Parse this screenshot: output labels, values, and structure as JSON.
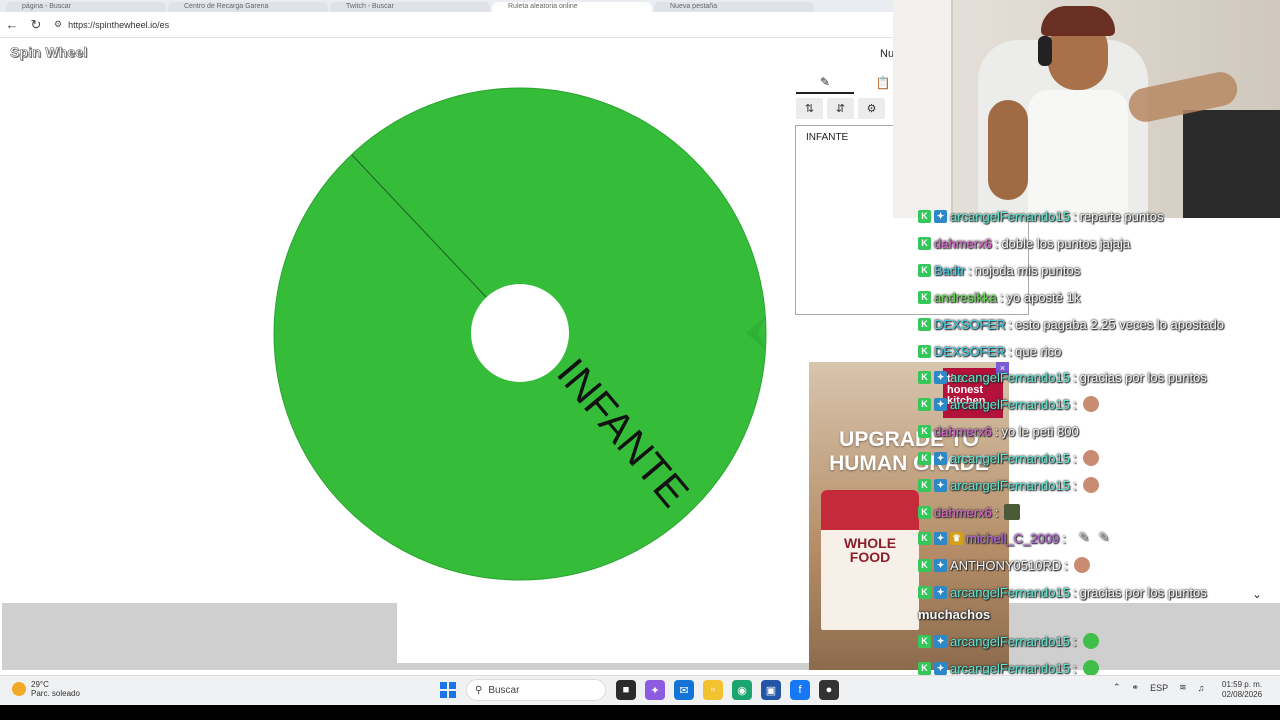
{
  "browser": {
    "tabs": [
      "página - Buscar",
      "Centro de Recarga Garena",
      "Twitch - Buscar",
      "Ruleta aleatoria online",
      "Nueva pestaña"
    ],
    "active_tab": 3,
    "url": "https://spinthewheel.io/es"
  },
  "site": {
    "logo": "Spin Wheel",
    "menu_truncated": "Nu"
  },
  "wheel": {
    "color": "#35bd3a",
    "segment_label": "INFANTE",
    "pointer_color": "#2fb136"
  },
  "editor": {
    "tab_edit_icon": "pencil-icon",
    "tab_results_icon": "clipboard-icon",
    "tools": [
      "shuffle-icon",
      "sort-icon",
      "settings-icon"
    ],
    "entries": [
      "INFANTE"
    ]
  },
  "ad": {
    "brand": "the honest kitchen",
    "headline": "UPGRADE TO HUMAN GRADE",
    "product": "WHOLE FOOD",
    "close": "×"
  },
  "chat": {
    "messages": [
      {
        "badges": [
          "k",
          "sub"
        ],
        "user": "arcangelFernando15",
        "color": "#5ee6cf",
        "text": "reparte puntos",
        "emote": ""
      },
      {
        "badges": [
          "k"
        ],
        "user": "dahmerx6",
        "color": "#e26ad2",
        "text": "doble los puntos jajaja",
        "emote": ""
      },
      {
        "badges": [
          "k"
        ],
        "user": "Badtr",
        "color": "#3fd2e8",
        "text": "nojoda mis puntos",
        "emote": ""
      },
      {
        "badges": [
          "k"
        ],
        "user": "andresikka",
        "color": "#63e04d",
        "text": "yo aposté 1k",
        "emote": ""
      },
      {
        "badges": [
          "k"
        ],
        "user": "DEXSOFER",
        "color": "#3fd2e8",
        "text": "esto pagaba 2.25 veces lo apostado",
        "emote": ""
      },
      {
        "badges": [
          "k"
        ],
        "user": "DEXSOFER",
        "color": "#3fd2e8",
        "text": "que rico",
        "emote": ""
      },
      {
        "badges": [
          "k",
          "sub"
        ],
        "user": "arcangelFernando15",
        "color": "#5ee6cf",
        "text": "gracias por los puntos",
        "emote": ""
      },
      {
        "badges": [
          "k",
          "sub"
        ],
        "user": "arcangelFernando15",
        "color": "#5ee6cf",
        "text": "",
        "emote": "face"
      },
      {
        "badges": [
          "k"
        ],
        "user": "dahmerx6",
        "color": "#e26ad2",
        "text": "yo le peti 800",
        "emote": ""
      },
      {
        "badges": [
          "k",
          "sub"
        ],
        "user": "arcangelFernando15",
        "color": "#5ee6cf",
        "text": "",
        "emote": "face"
      },
      {
        "badges": [
          "k",
          "sub"
        ],
        "user": "arcangelFernando15",
        "color": "#5ee6cf",
        "text": "",
        "emote": "face"
      },
      {
        "badges": [
          "k"
        ],
        "user": "dahmerx6",
        "color": "#e26ad2",
        "text": "",
        "emote": "dark"
      },
      {
        "badges": [
          "k",
          "sub",
          "crown"
        ],
        "user": "michell_C_2009",
        "color": "#c06ae8",
        "text": "",
        "emote": "pencil"
      },
      {
        "badges": [
          "k",
          "sub"
        ],
        "user": "ANTHONY0510RD",
        "color": "#f4f4f4",
        "text": "",
        "emote": "face"
      },
      {
        "badges": [
          "k",
          "sub"
        ],
        "user": "arcangelFernando15",
        "color": "#5ee6cf",
        "text": "gracias por los puntos",
        "emote": ""
      },
      {
        "badges": [],
        "user": "",
        "color": "#f4f4f4",
        "text": "muchachos",
        "emote": ""
      },
      {
        "badges": [
          "k",
          "sub"
        ],
        "user": "arcangelFernando15",
        "color": "#5ee6cf",
        "text": "",
        "emote": "green"
      },
      {
        "badges": [
          "k",
          "sub"
        ],
        "user": "arcangelFernando15",
        "color": "#5ee6cf",
        "text": "",
        "emote": "green"
      }
    ]
  },
  "taskbar": {
    "weather_temp": "29°C",
    "weather_desc": "Parc. soleado",
    "search_placeholder": "Buscar",
    "language": "ESP",
    "time": "01:59 p. m.",
    "date": "02/08/2026"
  }
}
